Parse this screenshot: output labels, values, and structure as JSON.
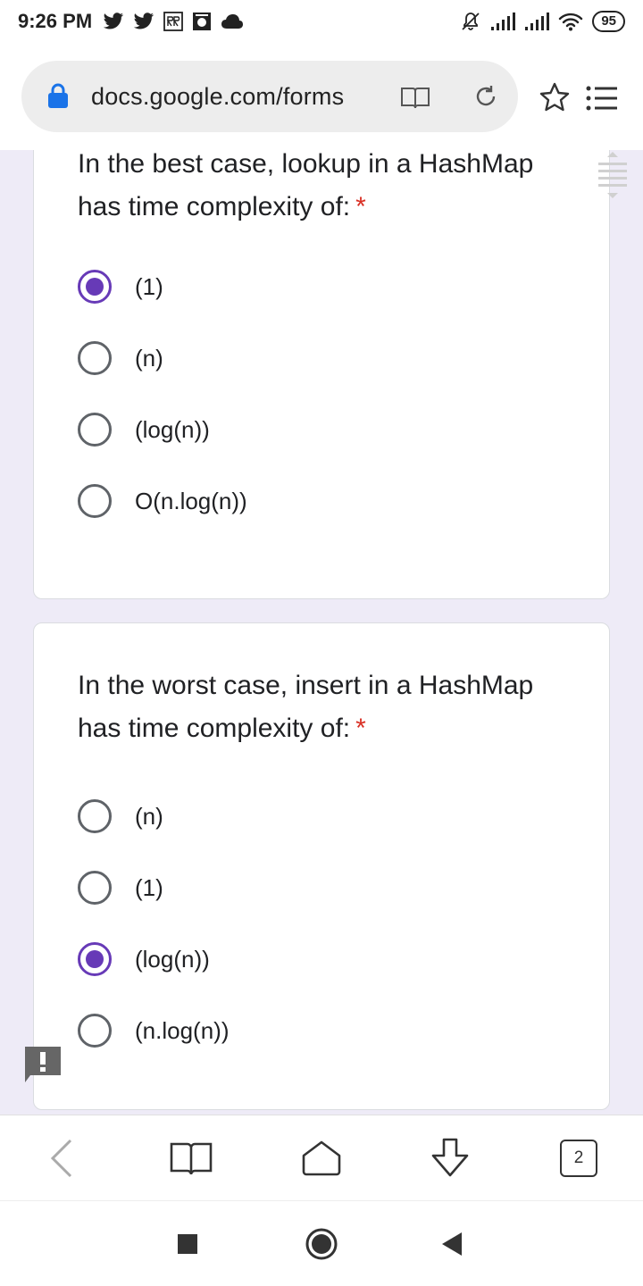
{
  "status_bar": {
    "time": "9:26 PM",
    "battery": "95",
    "icons_left": [
      "twitter-icon",
      "twitter-icon",
      "app-rr-icon",
      "app-gallery-icon",
      "cloud-icon"
    ],
    "icons_right": [
      "bell-off-icon",
      "signal-icon",
      "signal-icon",
      "wifi-icon",
      "battery-icon"
    ]
  },
  "browser": {
    "url": "docs.google.com/forms",
    "icons": [
      "lock-icon",
      "reader-mode-icon",
      "refresh-icon",
      "star-icon",
      "menu-icon"
    ]
  },
  "questions": [
    {
      "title": "In the best case, lookup in a HashMap has time complexity of:",
      "required_mark": "*",
      "options": [
        {
          "label": "(1)",
          "checked": true
        },
        {
          "label": "(n)",
          "checked": false
        },
        {
          "label": "(log(n))",
          "checked": false
        },
        {
          "label": "O(n.log(n))",
          "checked": false
        }
      ]
    },
    {
      "title": "In the worst case, insert in a HashMap has time complexity of:",
      "required_mark": "*",
      "options": [
        {
          "label": "(n)",
          "checked": false
        },
        {
          "label": "(1)",
          "checked": false
        },
        {
          "label": "(log(n))",
          "checked": true
        },
        {
          "label": "(n.log(n))",
          "checked": false
        }
      ]
    }
  ],
  "toolbar": {
    "tab_count": "2",
    "icons": [
      "back-icon",
      "bookmarks-icon",
      "home-icon",
      "download-icon",
      "tabs-icon"
    ]
  },
  "nav_bar": {
    "icons": [
      "recents-icon",
      "home-circle-icon",
      "back-triangle-icon"
    ]
  },
  "colors": {
    "accent": "#673ab7",
    "required": "#d93025",
    "form_background": "#eeebf7",
    "lock": "#1a73e8"
  }
}
